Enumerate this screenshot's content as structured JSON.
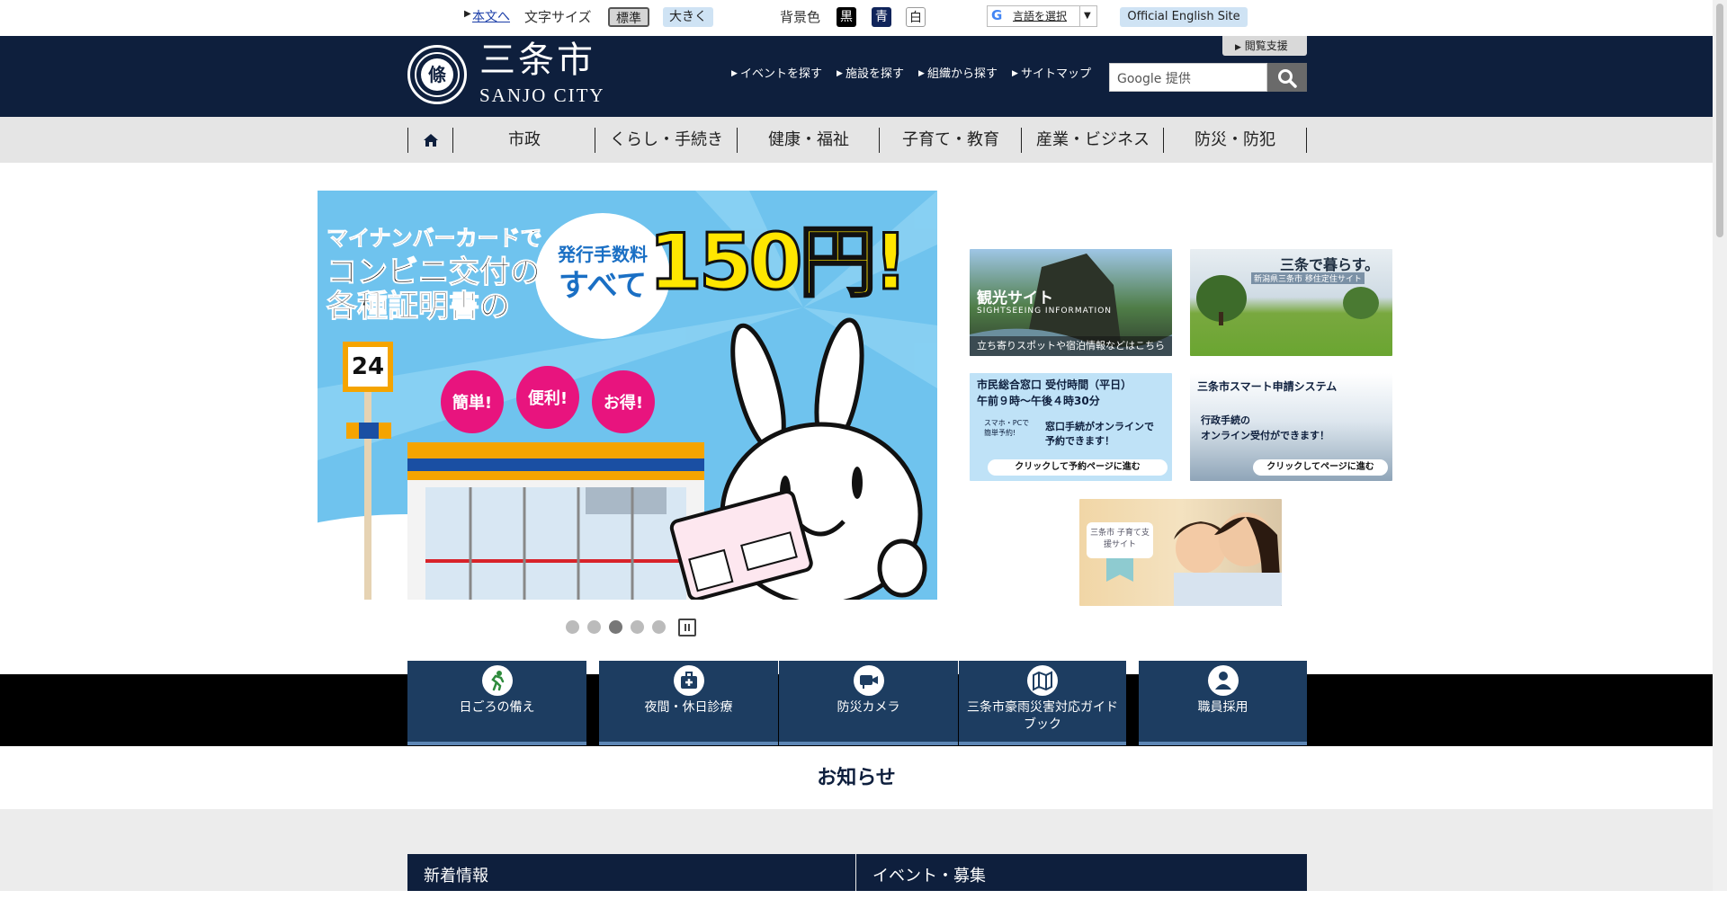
{
  "utility": {
    "skip_link": "本文へ",
    "font_size_label": "文字サイズ",
    "font_standard": "標準",
    "font_large": "大きく",
    "bg_label": "背景色",
    "bg_black": "黒",
    "bg_blue": "青",
    "bg_white": "白",
    "translate_label": "言語を選択",
    "english_site": "Official English Site"
  },
  "header": {
    "logo_kanji": "三条市",
    "logo_roman": "SANJO CITY",
    "logo_mark": "條",
    "reading_support": "閲覧支援",
    "links": [
      "イベントを探す",
      "施設を探す",
      "組織から探す",
      "サイトマップ"
    ],
    "search_placeholder": "Google 提供"
  },
  "gnav": [
    "市政",
    "くらし・手続き",
    "健康・福祉",
    "子育て・教育",
    "産業・ビジネス",
    "防災・防犯"
  ],
  "hero": {
    "line1": "マイナンバーカードで",
    "line2": "コンビニ交付の",
    "line3": "各種証明書の",
    "bubble_top": "発行手数料",
    "bubble_bottom": "すべて",
    "price": "150円!",
    "sign": "24",
    "balloons": [
      "簡単!",
      "便利!",
      "お得!"
    ]
  },
  "banners": {
    "sightseeing_title": "観光サイト",
    "sightseeing_sub": "SIGHTSEEING INFORMATION",
    "sightseeing_cap": "立ち寄りスポットや宿泊情報などはこちら",
    "living_title": "三条で暮らす。",
    "living_sub": "新潟県三条市 移住定住サイト",
    "window_title1": "市民総合窓口 受付時間（平日）",
    "window_title2": "午前９時～午後４時30分",
    "window_small": "スマホ・PCで簡単予約!",
    "window_body": "窓口手続がオンラインで予約できます！",
    "window_cap": "クリックして予約ページに進む",
    "smart_title": "三条市スマート申請システム",
    "smart_body1": "行政手続の",
    "smart_body2": "オンライン受付ができます！",
    "smart_cap": "クリックしてページに進む",
    "kosodate_label": "三条市 子育て支援サイト"
  },
  "quick_links": [
    "日ごろの備え",
    "夜間・休日診療",
    "防災カメラ",
    "三条市豪雨災害対応ガイドブック",
    "職員採用"
  ],
  "news": {
    "heading": "お知らせ",
    "tab_new": "新着情報",
    "tab_event": "イベント・募集"
  },
  "colors": {
    "header_navy": "#0e1f3d",
    "quick_blue": "#1d3d61",
    "hero_sky": "#6fc3ee",
    "price_yellow": "#ffe600"
  }
}
